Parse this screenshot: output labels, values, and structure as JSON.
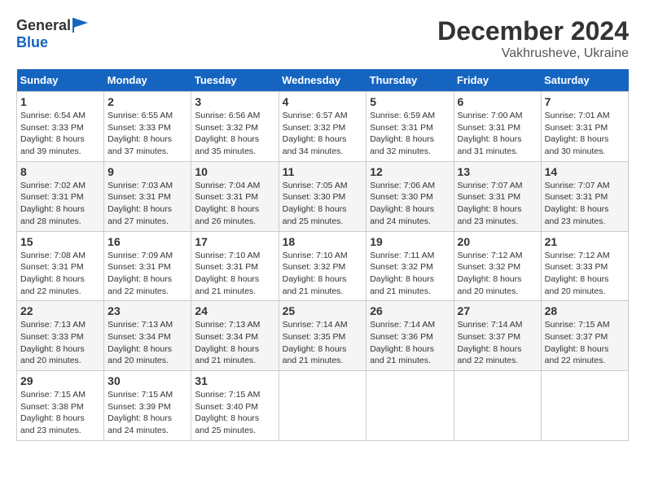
{
  "header": {
    "logo_general": "General",
    "logo_blue": "Blue",
    "month": "December 2024",
    "location": "Vakhrusheve, Ukraine"
  },
  "calendar": {
    "days_of_week": [
      "Sunday",
      "Monday",
      "Tuesday",
      "Wednesday",
      "Thursday",
      "Friday",
      "Saturday"
    ],
    "weeks": [
      [
        {
          "day": 1,
          "sunrise": "6:54 AM",
          "sunset": "3:33 PM",
          "daylight": "8 hours and 39 minutes."
        },
        {
          "day": 2,
          "sunrise": "6:55 AM",
          "sunset": "3:33 PM",
          "daylight": "8 hours and 37 minutes."
        },
        {
          "day": 3,
          "sunrise": "6:56 AM",
          "sunset": "3:32 PM",
          "daylight": "8 hours and 35 minutes."
        },
        {
          "day": 4,
          "sunrise": "6:57 AM",
          "sunset": "3:32 PM",
          "daylight": "8 hours and 34 minutes."
        },
        {
          "day": 5,
          "sunrise": "6:59 AM",
          "sunset": "3:31 PM",
          "daylight": "8 hours and 32 minutes."
        },
        {
          "day": 6,
          "sunrise": "7:00 AM",
          "sunset": "3:31 PM",
          "daylight": "8 hours and 31 minutes."
        },
        {
          "day": 7,
          "sunrise": "7:01 AM",
          "sunset": "3:31 PM",
          "daylight": "8 hours and 30 minutes."
        }
      ],
      [
        {
          "day": 8,
          "sunrise": "7:02 AM",
          "sunset": "3:31 PM",
          "daylight": "8 hours and 28 minutes."
        },
        {
          "day": 9,
          "sunrise": "7:03 AM",
          "sunset": "3:31 PM",
          "daylight": "8 hours and 27 minutes."
        },
        {
          "day": 10,
          "sunrise": "7:04 AM",
          "sunset": "3:31 PM",
          "daylight": "8 hours and 26 minutes."
        },
        {
          "day": 11,
          "sunrise": "7:05 AM",
          "sunset": "3:30 PM",
          "daylight": "8 hours and 25 minutes."
        },
        {
          "day": 12,
          "sunrise": "7:06 AM",
          "sunset": "3:30 PM",
          "daylight": "8 hours and 24 minutes."
        },
        {
          "day": 13,
          "sunrise": "7:07 AM",
          "sunset": "3:31 PM",
          "daylight": "8 hours and 23 minutes."
        },
        {
          "day": 14,
          "sunrise": "7:07 AM",
          "sunset": "3:31 PM",
          "daylight": "8 hours and 23 minutes."
        }
      ],
      [
        {
          "day": 15,
          "sunrise": "7:08 AM",
          "sunset": "3:31 PM",
          "daylight": "8 hours and 22 minutes."
        },
        {
          "day": 16,
          "sunrise": "7:09 AM",
          "sunset": "3:31 PM",
          "daylight": "8 hours and 22 minutes."
        },
        {
          "day": 17,
          "sunrise": "7:10 AM",
          "sunset": "3:31 PM",
          "daylight": "8 hours and 21 minutes."
        },
        {
          "day": 18,
          "sunrise": "7:10 AM",
          "sunset": "3:32 PM",
          "daylight": "8 hours and 21 minutes."
        },
        {
          "day": 19,
          "sunrise": "7:11 AM",
          "sunset": "3:32 PM",
          "daylight": "8 hours and 21 minutes."
        },
        {
          "day": 20,
          "sunrise": "7:12 AM",
          "sunset": "3:32 PM",
          "daylight": "8 hours and 20 minutes."
        },
        {
          "day": 21,
          "sunrise": "7:12 AM",
          "sunset": "3:33 PM",
          "daylight": "8 hours and 20 minutes."
        }
      ],
      [
        {
          "day": 22,
          "sunrise": "7:13 AM",
          "sunset": "3:33 PM",
          "daylight": "8 hours and 20 minutes."
        },
        {
          "day": 23,
          "sunrise": "7:13 AM",
          "sunset": "3:34 PM",
          "daylight": "8 hours and 20 minutes."
        },
        {
          "day": 24,
          "sunrise": "7:13 AM",
          "sunset": "3:34 PM",
          "daylight": "8 hours and 21 minutes."
        },
        {
          "day": 25,
          "sunrise": "7:14 AM",
          "sunset": "3:35 PM",
          "daylight": "8 hours and 21 minutes."
        },
        {
          "day": 26,
          "sunrise": "7:14 AM",
          "sunset": "3:36 PM",
          "daylight": "8 hours and 21 minutes."
        },
        {
          "day": 27,
          "sunrise": "7:14 AM",
          "sunset": "3:37 PM",
          "daylight": "8 hours and 22 minutes."
        },
        {
          "day": 28,
          "sunrise": "7:15 AM",
          "sunset": "3:37 PM",
          "daylight": "8 hours and 22 minutes."
        }
      ],
      [
        {
          "day": 29,
          "sunrise": "7:15 AM",
          "sunset": "3:38 PM",
          "daylight": "8 hours and 23 minutes."
        },
        {
          "day": 30,
          "sunrise": "7:15 AM",
          "sunset": "3:39 PM",
          "daylight": "8 hours and 24 minutes."
        },
        {
          "day": 31,
          "sunrise": "7:15 AM",
          "sunset": "3:40 PM",
          "daylight": "8 hours and 25 minutes."
        },
        null,
        null,
        null,
        null
      ]
    ]
  }
}
